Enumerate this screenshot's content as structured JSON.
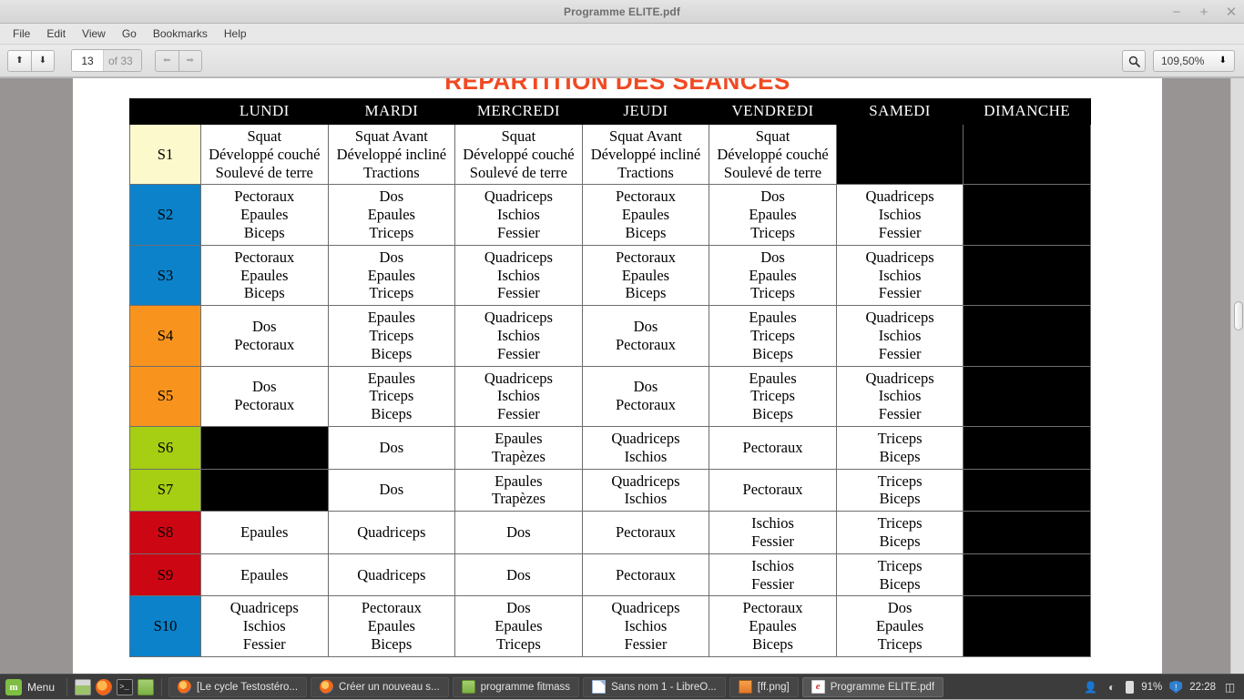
{
  "window": {
    "title": "Programme ELITE.pdf",
    "controls": {
      "minimize": "−",
      "maximize": "+",
      "close": "✕"
    }
  },
  "menubar": {
    "items": [
      "File",
      "Edit",
      "View",
      "Go",
      "Bookmarks",
      "Help"
    ]
  },
  "toolbar": {
    "page_up_icon": "⬆",
    "page_down_icon": "⬇",
    "page_number": "13",
    "page_total": "of 33",
    "prev_icon": "⬅",
    "next_icon": "➡",
    "search_icon": "search-icon",
    "zoom_value": "109,50%",
    "zoom_caret": "⬇"
  },
  "document": {
    "title": "RÉPARTITION DES SÉANCES",
    "title_color": "#f04a23",
    "table": {
      "columns": [
        "",
        "LUNDI",
        "MARDI",
        "MERCREDI",
        "JEUDI",
        "VENDREDI",
        "SAMEDI",
        "DIMANCHE"
      ],
      "week_colors": {
        "S1": "#fcf9cd",
        "S2": "#0c82ca",
        "S3": "#0c82ca",
        "S4": "#f8941e",
        "S5": "#f8941e",
        "S6": "#a6ce12",
        "S7": "#a6ce12",
        "S8": "#cc0713",
        "S9": "#cc0713",
        "S10": "#0c82ca"
      },
      "rows": [
        {
          "week": "S1",
          "cells": [
            [
              "Squat",
              "Développé couché",
              "Soulevé de terre"
            ],
            [
              "Squat Avant",
              "Développé incliné",
              "Tractions"
            ],
            [
              "Squat",
              "Développé couché",
              "Soulevé de terre"
            ],
            [
              "Squat Avant",
              "Développé incliné",
              "Tractions"
            ],
            [
              "Squat",
              "Développé couché",
              "Soulevé de terre"
            ],
            null,
            null
          ]
        },
        {
          "week": "S2",
          "cells": [
            [
              "Pectoraux",
              "Epaules",
              "Biceps"
            ],
            [
              "Dos",
              "Epaules",
              "Triceps"
            ],
            [
              "Quadriceps",
              "Ischios",
              "Fessier"
            ],
            [
              "Pectoraux",
              "Epaules",
              "Biceps"
            ],
            [
              "Dos",
              "Epaules",
              "Triceps"
            ],
            [
              "Quadriceps",
              "Ischios",
              "Fessier"
            ],
            null
          ]
        },
        {
          "week": "S3",
          "cells": [
            [
              "Pectoraux",
              "Epaules",
              "Biceps"
            ],
            [
              "Dos",
              "Epaules",
              "Triceps"
            ],
            [
              "Quadriceps",
              "Ischios",
              "Fessier"
            ],
            [
              "Pectoraux",
              "Epaules",
              "Biceps"
            ],
            [
              "Dos",
              "Epaules",
              "Triceps"
            ],
            [
              "Quadriceps",
              "Ischios",
              "Fessier"
            ],
            null
          ]
        },
        {
          "week": "S4",
          "cells": [
            [
              "Dos",
              "Pectoraux"
            ],
            [
              "Epaules",
              "Triceps",
              "Biceps"
            ],
            [
              "Quadriceps",
              "Ischios",
              "Fessier"
            ],
            [
              "Dos",
              "Pectoraux"
            ],
            [
              "Epaules",
              "Triceps",
              "Biceps"
            ],
            [
              "Quadriceps",
              "Ischios",
              "Fessier"
            ],
            null
          ]
        },
        {
          "week": "S5",
          "cells": [
            [
              "Dos",
              "Pectoraux"
            ],
            [
              "Epaules",
              "Triceps",
              "Biceps"
            ],
            [
              "Quadriceps",
              "Ischios",
              "Fessier"
            ],
            [
              "Dos",
              "Pectoraux"
            ],
            [
              "Epaules",
              "Triceps",
              "Biceps"
            ],
            [
              "Quadriceps",
              "Ischios",
              "Fessier"
            ],
            null
          ]
        },
        {
          "week": "S6",
          "cells": [
            null,
            [
              "Dos"
            ],
            [
              "Epaules",
              "Trapèzes"
            ],
            [
              "Quadriceps",
              "Ischios"
            ],
            [
              "Pectoraux"
            ],
            [
              "Triceps",
              "Biceps"
            ],
            null
          ]
        },
        {
          "week": "S7",
          "cells": [
            null,
            [
              "Dos"
            ],
            [
              "Epaules",
              "Trapèzes"
            ],
            [
              "Quadriceps",
              "Ischios"
            ],
            [
              "Pectoraux"
            ],
            [
              "Triceps",
              "Biceps"
            ],
            null
          ]
        },
        {
          "week": "S8",
          "cells": [
            [
              "Epaules"
            ],
            [
              "Quadriceps"
            ],
            [
              "Dos"
            ],
            [
              "Pectoraux"
            ],
            [
              "Ischios",
              "Fessier"
            ],
            [
              "Triceps",
              "Biceps"
            ],
            null
          ]
        },
        {
          "week": "S9",
          "cells": [
            [
              "Epaules"
            ],
            [
              "Quadriceps"
            ],
            [
              "Dos"
            ],
            [
              "Pectoraux"
            ],
            [
              "Ischios",
              "Fessier"
            ],
            [
              "Triceps",
              "Biceps"
            ],
            null
          ]
        },
        {
          "week": "S10",
          "cells": [
            [
              "Quadriceps",
              "Ischios",
              "Fessier"
            ],
            [
              "Pectoraux",
              "Epaules",
              "Biceps"
            ],
            [
              "Dos",
              "Epaules",
              "Triceps"
            ],
            [
              "Quadriceps",
              "Ischios",
              "Fessier"
            ],
            [
              "Pectoraux",
              "Epaules",
              "Biceps"
            ],
            [
              "Dos",
              "Epaules",
              "Triceps"
            ],
            null
          ]
        }
      ]
    }
  },
  "taskbar": {
    "menu_label": "Menu",
    "quicklaunch": [
      "show-desktop-icon",
      "firefox-icon",
      "terminal-icon",
      "files-icon"
    ],
    "tasks": [
      {
        "label": "[Le cycle Testostéro...",
        "icon": "firefox-icon",
        "active": false
      },
      {
        "label": "Créer un nouveau s...",
        "icon": "firefox-icon",
        "active": false
      },
      {
        "label": "programme fitmass",
        "icon": "folder-icon",
        "active": false
      },
      {
        "label": "Sans nom 1 - LibreO...",
        "icon": "document-icon",
        "active": false
      },
      {
        "label": "[ff.png]",
        "icon": "image-icon",
        "active": false
      },
      {
        "label": "Programme ELITE.pdf",
        "icon": "pdf-icon",
        "active": true
      }
    ],
    "tray": {
      "user_icon": "user-icon",
      "wifi_icon": "wifi-icon",
      "battery_icon": "battery-icon",
      "battery_percent": "91%",
      "shield_icon": "shield-icon",
      "clock": "22:28",
      "workspace_icon": "workspace-switcher-icon"
    }
  }
}
